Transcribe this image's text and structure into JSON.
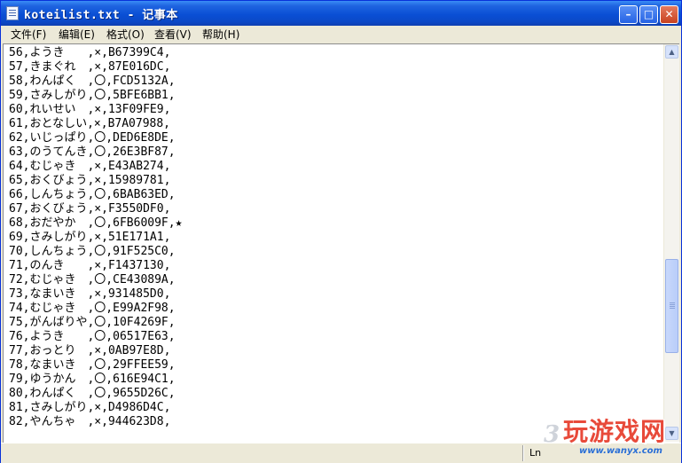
{
  "window": {
    "title": "koteilist.txt - 记事本",
    "controls": {
      "minimize": "–",
      "maximize": "□",
      "close": "✕"
    }
  },
  "menubar": {
    "items": [
      "文件(F)",
      "编辑(E)",
      "格式(O)",
      "查看(V)",
      "帮助(H)"
    ]
  },
  "document": {
    "lines": [
      "56,ようき　　,×,B67399C4,",
      "57,きまぐれ　,×,87E016DC,",
      "58,わんぱく　,〇,FCD5132A,",
      "59,さみしがり,〇,5BFE6BB1,",
      "60,れいせい　,×,13F09FE9,",
      "61,おとなしい,×,B7A07988,",
      "62,いじっぱり,〇,DED6E8DE,",
      "63,のうてんき,〇,26E3BF87,",
      "64,むじゃき　,×,E43AB274,",
      "65,おくびょう,×,15989781,",
      "66,しんちょう,〇,6BAB63ED,",
      "67,おくびょう,×,F3550DF0,",
      "68,おだやか　,〇,6FB6009F,★",
      "69,さみしがり,×,51E171A1,",
      "70,しんちょう,〇,91F525C0,",
      "71,のんき　　,×,F1437130,",
      "72,むじゃき　,〇,CE43089A,",
      "73,なまいき　,×,931485D0,",
      "74,むじゃき　,〇,E99A2F98,",
      "75,がんばりや,〇,10F4269F,",
      "76,ようき　　,〇,06517E63,",
      "77,おっとり　,×,0AB97E8D,",
      "78,なまいき　,〇,29FFEE59,",
      "79,ゆうかん　,〇,616E94C1,",
      "80,わんぱく　,〇,9655D26C,",
      "81,さみしがり,×,D4986D4C,",
      "82,やんちゃ　,×,944623D8,"
    ]
  },
  "scrollbar": {
    "up_icon": "▲",
    "down_icon": "▼"
  },
  "statusbar": {
    "position": "Ln"
  },
  "watermark": {
    "logo": "玩游戏网",
    "url": "www.wanyx.com",
    "badge": "3"
  }
}
